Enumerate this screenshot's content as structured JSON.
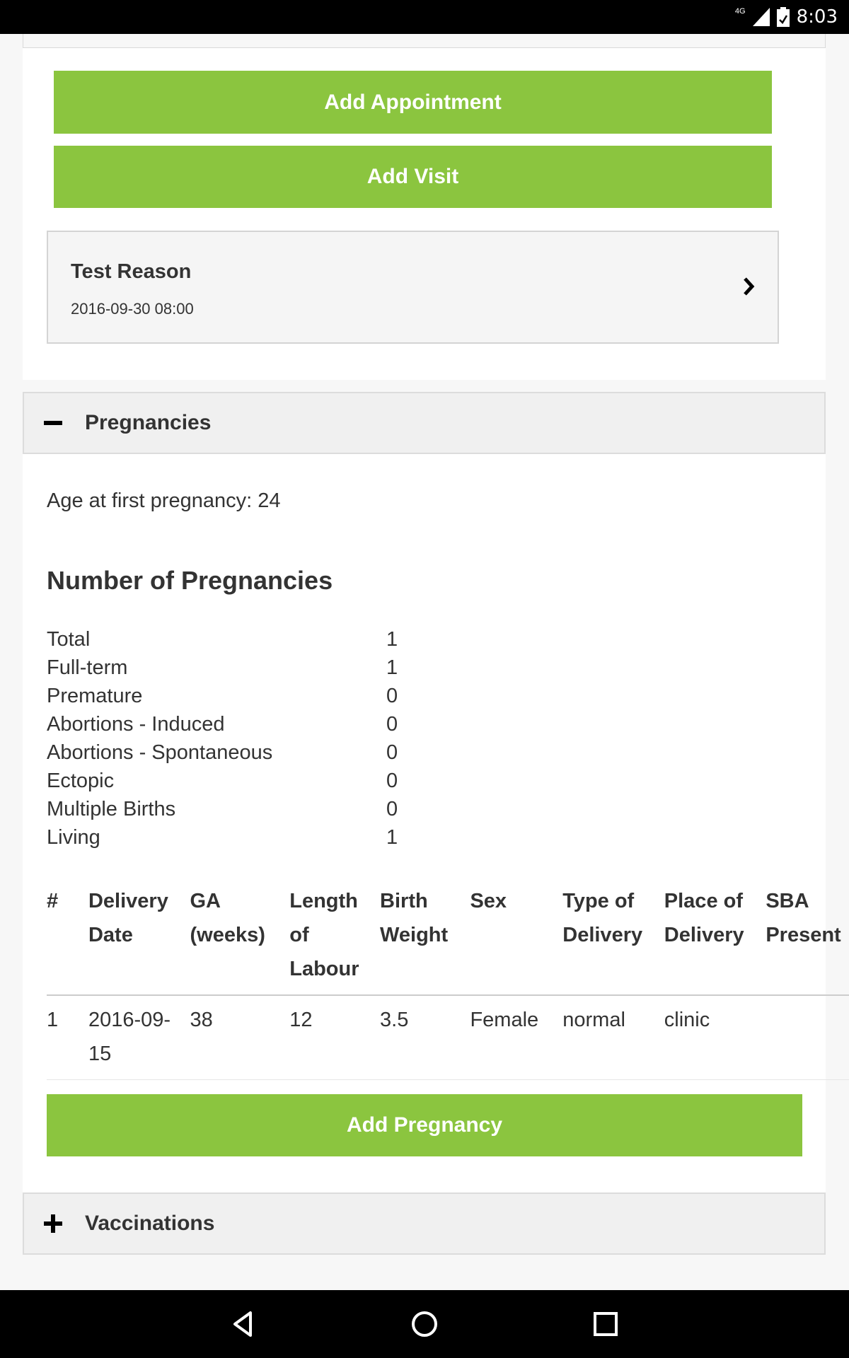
{
  "status_bar": {
    "network": "4G",
    "time": "8:03"
  },
  "buttons": {
    "add_appointment": "Add Appointment",
    "add_visit": "Add Visit",
    "add_pregnancy": "Add Pregnancy"
  },
  "appointment": {
    "title": "Test Reason",
    "datetime": "2016-09-30 08:00"
  },
  "pregnancies": {
    "header": "Pregnancies",
    "age_first": "Age at first pregnancy: 24",
    "heading": "Number of Pregnancies",
    "counts": [
      {
        "label": "Total",
        "value": "1"
      },
      {
        "label": "Full-term",
        "value": "1"
      },
      {
        "label": "Premature",
        "value": "0"
      },
      {
        "label": "Abortions - Induced",
        "value": "0"
      },
      {
        "label": "Abortions - Spontaneous",
        "value": "0"
      },
      {
        "label": "Ectopic",
        "value": "0"
      },
      {
        "label": "Multiple Births",
        "value": "0"
      },
      {
        "label": "Living",
        "value": "1"
      }
    ],
    "table": {
      "headers": [
        "#",
        "Delivery Date",
        "GA (weeks)",
        "Length of Labour",
        "Birth Weight",
        "Sex",
        "Type of Delivery",
        "Place of Delivery",
        "SBA Present"
      ],
      "rows": [
        [
          "1",
          "2016-09-15",
          "38",
          "12",
          "3.5",
          "Female",
          "normal",
          "clinic",
          ""
        ]
      ]
    }
  },
  "vaccinations": {
    "header": "Vaccinations"
  }
}
